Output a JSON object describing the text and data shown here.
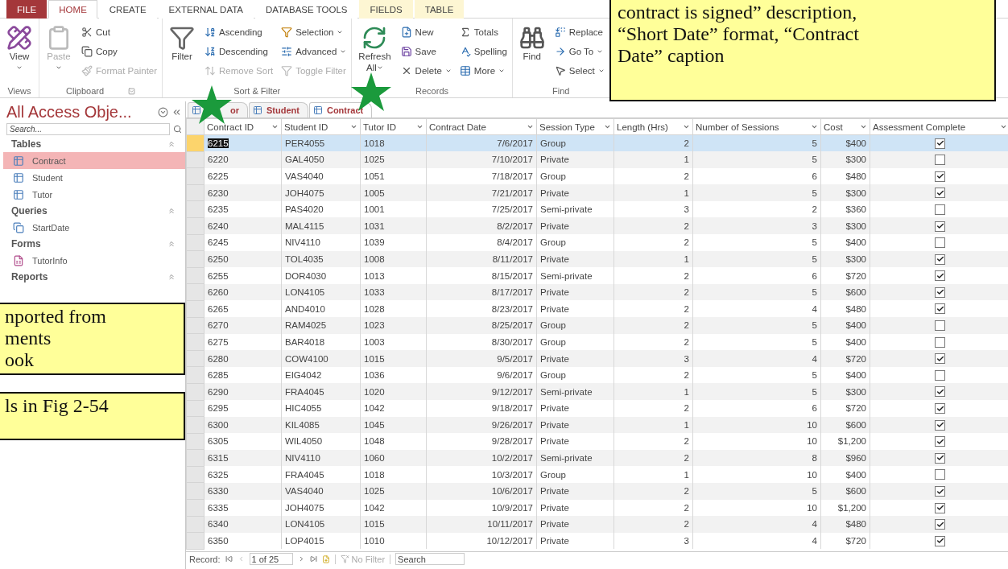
{
  "ribbon_tabs": [
    {
      "label": "FILE",
      "kind": "file",
      "selected": false
    },
    {
      "label": "HOME",
      "kind": "normal",
      "selected": true
    },
    {
      "label": "CREATE",
      "kind": "normal",
      "selected": false
    },
    {
      "label": "EXTERNAL DATA",
      "kind": "normal",
      "selected": false
    },
    {
      "label": "DATABASE TOOLS",
      "kind": "normal",
      "selected": false
    },
    {
      "label": "FIELDS",
      "kind": "context",
      "selected": false
    },
    {
      "label": "TABLE",
      "kind": "context",
      "selected": false
    }
  ],
  "ribbon_groups": [
    {
      "label": "Views",
      "launcher": false,
      "columns": [
        [
          {
            "label": "View",
            "kind": "large",
            "dropdown": true,
            "disabled": false
          }
        ]
      ]
    },
    {
      "label": "Clipboard",
      "launcher": true,
      "columns": [
        [
          {
            "label": "Paste",
            "kind": "large",
            "dropdown": true,
            "disabled": true
          }
        ],
        [
          {
            "label": "Cut",
            "kind": "small",
            "dropdown": false,
            "disabled": false
          },
          {
            "label": "Copy",
            "kind": "small",
            "dropdown": false,
            "disabled": false
          },
          {
            "label": "Format Painter",
            "kind": "small",
            "dropdown": false,
            "disabled": true
          }
        ]
      ]
    },
    {
      "label": "Sort & Filter",
      "launcher": false,
      "columns": [
        [
          {
            "label": "Filter",
            "kind": "large",
            "dropdown": false,
            "disabled": false
          }
        ],
        [
          {
            "label": "Ascending",
            "kind": "small",
            "dropdown": false,
            "disabled": false
          },
          {
            "label": "Descending",
            "kind": "small",
            "dropdown": false,
            "disabled": false
          },
          {
            "label": "Remove Sort",
            "kind": "small",
            "dropdown": false,
            "disabled": true
          }
        ],
        [
          {
            "label": "Selection",
            "kind": "small",
            "dropdown": true,
            "disabled": false
          },
          {
            "label": "Advanced",
            "kind": "small",
            "dropdown": true,
            "disabled": false
          },
          {
            "label": "Toggle Filter",
            "kind": "small",
            "dropdown": false,
            "disabled": true
          }
        ]
      ]
    },
    {
      "label": "Records",
      "launcher": false,
      "columns": [
        [
          {
            "label": "Refresh All",
            "kind": "large",
            "dropdown": true,
            "disabled": false
          }
        ],
        [
          {
            "label": "New",
            "kind": "small",
            "dropdown": false,
            "disabled": false
          },
          {
            "label": "Save",
            "kind": "small",
            "dropdown": false,
            "disabled": false
          },
          {
            "label": "Delete",
            "kind": "small",
            "dropdown": true,
            "disabled": false
          }
        ],
        [
          {
            "label": "Totals",
            "kind": "small",
            "dropdown": false,
            "disabled": false
          },
          {
            "label": "Spelling",
            "kind": "small",
            "dropdown": false,
            "disabled": false
          },
          {
            "label": "More",
            "kind": "small",
            "dropdown": true,
            "disabled": false
          }
        ]
      ]
    },
    {
      "label": "Find",
      "launcher": false,
      "columns": [
        [
          {
            "label": "Find",
            "kind": "large",
            "dropdown": false,
            "disabled": false
          }
        ],
        [
          {
            "label": "Replace",
            "kind": "small",
            "dropdown": false,
            "disabled": false
          },
          {
            "label": "Go To",
            "kind": "small",
            "dropdown": true,
            "disabled": false
          },
          {
            "label": "Select",
            "kind": "small",
            "dropdown": true,
            "disabled": false
          }
        ]
      ]
    }
  ],
  "navigation_pane": {
    "title": "All Access Obje...",
    "search": {
      "placeholder": "Search..."
    },
    "groups": [
      {
        "label": "Tables",
        "items": [
          {
            "label": "Contract",
            "selected": true
          },
          {
            "label": "Student",
            "selected": false
          },
          {
            "label": "Tutor",
            "selected": false
          }
        ]
      },
      {
        "label": "Queries",
        "items": [
          {
            "label": "StartDate",
            "selected": false
          }
        ]
      },
      {
        "label": "Forms",
        "items": [
          {
            "label": "TutorInfo",
            "selected": false
          }
        ]
      },
      {
        "label": "Reports"
      }
    ]
  },
  "document_tabs": [
    {
      "label": "or",
      "selected": false
    },
    {
      "label": "Student",
      "selected": false
    },
    {
      "label": "Contract",
      "selected": true
    }
  ],
  "table": {
    "columns": [
      "Contract ID",
      "Student ID",
      "Tutor ID",
      "Contract Date",
      "Session Type",
      "Length (Hrs)",
      "Number of Sessions",
      "Cost",
      "Assessment Complete"
    ],
    "rows": [
      {
        "cells": [
          "6215",
          "PER4055",
          "1018",
          "7/6/2017",
          "Group",
          "2",
          "5",
          "$400"
        ],
        "assessment_complete": true,
        "selected": true
      },
      {
        "cells": [
          "6220",
          "GAL4050",
          "1025",
          "7/10/2017",
          "Private",
          "1",
          "5",
          "$300"
        ],
        "assessment_complete": false,
        "selected": false
      },
      {
        "cells": [
          "6225",
          "VAS4040",
          "1051",
          "7/18/2017",
          "Group",
          "2",
          "6",
          "$480"
        ],
        "assessment_complete": true,
        "selected": false
      },
      {
        "cells": [
          "6230",
          "JOH4075",
          "1005",
          "7/21/2017",
          "Private",
          "1",
          "5",
          "$300"
        ],
        "assessment_complete": true,
        "selected": false
      },
      {
        "cells": [
          "6235",
          "PAS4020",
          "1001",
          "7/25/2017",
          "Semi-private",
          "3",
          "2",
          "$360"
        ],
        "assessment_complete": false,
        "selected": false
      },
      {
        "cells": [
          "6240",
          "MAL4115",
          "1031",
          "8/2/2017",
          "Private",
          "2",
          "3",
          "$300"
        ],
        "assessment_complete": true,
        "selected": false
      },
      {
        "cells": [
          "6245",
          "NIV4110",
          "1039",
          "8/4/2017",
          "Group",
          "2",
          "5",
          "$400"
        ],
        "assessment_complete": false,
        "selected": false
      },
      {
        "cells": [
          "6250",
          "TOL4035",
          "1008",
          "8/11/2017",
          "Private",
          "1",
          "5",
          "$300"
        ],
        "assessment_complete": true,
        "selected": false
      },
      {
        "cells": [
          "6255",
          "DOR4030",
          "1013",
          "8/15/2017",
          "Semi-private",
          "2",
          "6",
          "$720"
        ],
        "assessment_complete": true,
        "selected": false
      },
      {
        "cells": [
          "6260",
          "LON4105",
          "1033",
          "8/17/2017",
          "Private",
          "2",
          "5",
          "$600"
        ],
        "assessment_complete": true,
        "selected": false
      },
      {
        "cells": [
          "6265",
          "AND4010",
          "1028",
          "8/23/2017",
          "Private",
          "2",
          "4",
          "$480"
        ],
        "assessment_complete": true,
        "selected": false
      },
      {
        "cells": [
          "6270",
          "RAM4025",
          "1023",
          "8/25/2017",
          "Group",
          "2",
          "5",
          "$400"
        ],
        "assessment_complete": false,
        "selected": false
      },
      {
        "cells": [
          "6275",
          "BAR4018",
          "1003",
          "8/30/2017",
          "Group",
          "2",
          "5",
          "$400"
        ],
        "assessment_complete": false,
        "selected": false
      },
      {
        "cells": [
          "6280",
          "COW4100",
          "1015",
          "9/5/2017",
          "Private",
          "3",
          "4",
          "$720"
        ],
        "assessment_complete": true,
        "selected": false
      },
      {
        "cells": [
          "6285",
          "EIG4042",
          "1036",
          "9/6/2017",
          "Group",
          "2",
          "5",
          "$400"
        ],
        "assessment_complete": false,
        "selected": false
      },
      {
        "cells": [
          "6290",
          "FRA4045",
          "1020",
          "9/12/2017",
          "Semi-private",
          "1",
          "5",
          "$300"
        ],
        "assessment_complete": true,
        "selected": false
      },
      {
        "cells": [
          "6295",
          "HIC4055",
          "1042",
          "9/18/2017",
          "Private",
          "2",
          "6",
          "$720"
        ],
        "assessment_complete": true,
        "selected": false
      },
      {
        "cells": [
          "6300",
          "KIL4085",
          "1045",
          "9/26/2017",
          "Private",
          "1",
          "10",
          "$600"
        ],
        "assessment_complete": true,
        "selected": false
      },
      {
        "cells": [
          "6305",
          "WIL4050",
          "1048",
          "9/28/2017",
          "Private",
          "2",
          "10",
          "$1,200"
        ],
        "assessment_complete": true,
        "selected": false
      },
      {
        "cells": [
          "6315",
          "NIV4110",
          "1060",
          "10/2/2017",
          "Semi-private",
          "2",
          "8",
          "$960"
        ],
        "assessment_complete": true,
        "selected": false
      },
      {
        "cells": [
          "6325",
          "FRA4045",
          "1018",
          "10/3/2017",
          "Group",
          "1",
          "10",
          "$400"
        ],
        "assessment_complete": false,
        "selected": false
      },
      {
        "cells": [
          "6330",
          "VAS4040",
          "1025",
          "10/6/2017",
          "Private",
          "2",
          "5",
          "$600"
        ],
        "assessment_complete": true,
        "selected": false
      },
      {
        "cells": [
          "6335",
          "JOH4075",
          "1042",
          "10/9/2017",
          "Private",
          "2",
          "10",
          "$1,200"
        ],
        "assessment_complete": true,
        "selected": false
      },
      {
        "cells": [
          "6340",
          "LON4105",
          "1015",
          "10/11/2017",
          "Private",
          "2",
          "4",
          "$480"
        ],
        "assessment_complete": true,
        "selected": false
      },
      {
        "cells": [
          "6350",
          "LOP4015",
          "1010",
          "10/12/2017",
          "Private",
          "3",
          "4",
          "$720"
        ],
        "assessment_complete": true,
        "selected": false
      }
    ]
  },
  "record_bar": {
    "label": "Record:",
    "position": "1 of 25",
    "filter": {
      "label": "No Filter",
      "disabled": true
    },
    "search": {
      "placeholder": "Search"
    }
  },
  "callouts": [
    {
      "lines": [
        "contract is signed” description,",
        "“Short Date” format, “Contract",
        "Date” caption"
      ]
    },
    {
      "lines": [
        "nported from",
        "ments",
        "ook"
      ]
    },
    {
      "lines": [
        "ls in Fig 2-54"
      ]
    }
  ]
}
